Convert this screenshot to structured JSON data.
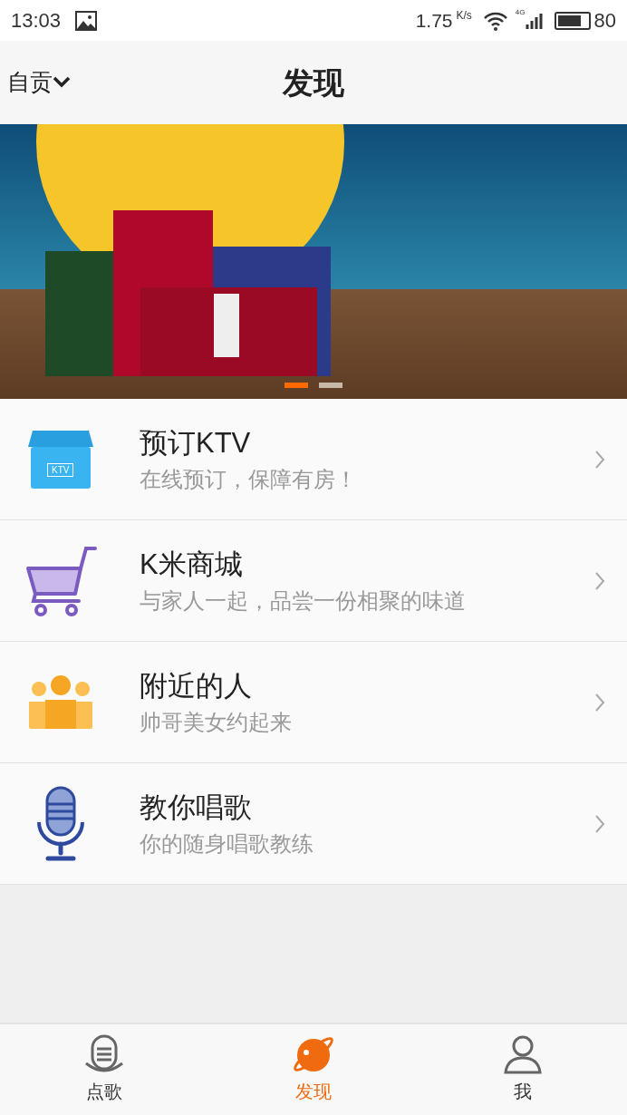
{
  "status_bar": {
    "time": "13:03",
    "speed": "1.75",
    "speed_unit": "K/s",
    "network": "4G",
    "battery": "80",
    "battery_meter": {
      "level": 0.8
    }
  },
  "header": {
    "left_label": "自贡",
    "title": "发现"
  },
  "banner": {
    "dots": [
      {
        "selected": true
      },
      {
        "selected": false
      }
    ]
  },
  "items": [
    {
      "kind": "ktv",
      "title": "预订KTV",
      "subtitle": "在线预订，保障有房！",
      "icon_text": "KTV"
    },
    {
      "kind": "cart",
      "title": "K米商城",
      "subtitle": "与家人一起，品尝一份相聚的味道"
    },
    {
      "kind": "people",
      "title": "附近的人",
      "subtitle": "帅哥美女约起来"
    },
    {
      "kind": "mic",
      "title": "教你唱歌",
      "subtitle": "你的随身唱歌教练"
    }
  ],
  "tab_bar": [
    {
      "kind": "mic",
      "label": "点歌",
      "selected": false
    },
    {
      "kind": "planet",
      "label": "发现",
      "selected": true
    },
    {
      "kind": "person",
      "label": "我",
      "selected": false
    }
  ]
}
